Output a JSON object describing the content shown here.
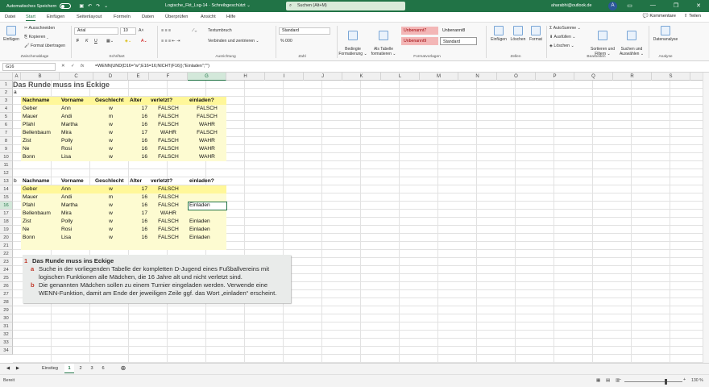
{
  "titlebar": {
    "autosave": "Automatisches Speichern",
    "doc": "Logische_Fkt_Lsg-14  ·  Schreibgeschützt ⌄",
    "search": "Suchen (Alt+M)",
    "user": "aharabhi@outlook.de",
    "avatar": "A",
    "min": "—",
    "max": "❐",
    "close": "✕",
    "ribbon_opt": "▭"
  },
  "menu": {
    "items": [
      "Datei",
      "Start",
      "Einfügen",
      "Seitenlayout",
      "Formeln",
      "Daten",
      "Überprüfen",
      "Ansicht",
      "Hilfe"
    ],
    "comments": "💬 Kommentare",
    "share": "⇧ Teilen"
  },
  "ribbon": {
    "paste": "Einfügen",
    "cut": "✂ Ausschneiden",
    "copy": "⎘ Kopieren ⌄",
    "painter": "🖌 Format übertragen",
    "clipboard": "Zwischenablage",
    "font": "Arial",
    "size": "10",
    "bold": "F",
    "italic": "K",
    "underline": "U",
    "grow": "A˄",
    "shrink": "A˅",
    "font_label": "Schriftart",
    "wrap": "Textumbruch",
    "merge": "Verbinden und zentrieren ⌄",
    "align_label": "Ausrichtung",
    "numfmt": "Standard",
    "num_label": "Zahl",
    "pct": "% 000",
    "cond": "Bedingte\nFormatierung ⌄",
    "table": "Als Tabelle\nformatieren ⌄",
    "styles_label": "Formatvorlagen",
    "style1": "Unbenannt7",
    "style2": "Unbenannt8",
    "style3": "Unbenannt9",
    "style4": "Standard",
    "ins": "Einfügen",
    "del": "Löschen",
    "fmt": "Format",
    "cells_label": "Zellen",
    "autosum": "Σ AutoSumme ⌄",
    "fill": "⬇ Ausfüllen ⌄",
    "clear": "◈ Löschen ⌄",
    "sort": "Sortieren und\nFiltern ⌄",
    "find": "Suchen und\nAuswählen ⌄",
    "edit_label": "Bearbeiten",
    "analyze": "Datenanalyse",
    "analyze_label": "Analyse"
  },
  "formula": {
    "cell": "G16",
    "fx": "fx",
    "text": "=WENN(UND(D16=\"w\";E16=16;NICHT(F16));\"Einladen\";\"\")"
  },
  "columns": [
    "A",
    "B",
    "C",
    "D",
    "E",
    "F",
    "G",
    "H",
    "I",
    "J",
    "K",
    "L",
    "M",
    "N",
    "O",
    "P",
    "Q",
    "R",
    "S"
  ],
  "rows": [
    "1",
    "2",
    "3",
    "4",
    "5",
    "6",
    "7",
    "8",
    "9",
    "10",
    "11",
    "12",
    "13",
    "14",
    "15",
    "16",
    "17",
    "18",
    "19",
    "20",
    "21",
    "22",
    "23",
    "24",
    "25",
    "26",
    "27",
    "28",
    "29",
    "30",
    "31",
    "32",
    "33",
    "34"
  ],
  "sheet": {
    "title": "Das Runde muss ins Eckige",
    "label_a": "a",
    "label_b": "b",
    "headers": [
      "Nachname",
      "Vorname",
      "Geschlecht",
      "Alter",
      "verletzt?",
      "einladen?"
    ],
    "table_a": [
      [
        "Geber",
        "Ann",
        "w",
        "17",
        "FALSCH",
        "FALSCH"
      ],
      [
        "Mauer",
        "Andi",
        "m",
        "16",
        "FALSCH",
        "FALSCH"
      ],
      [
        "Pfahl",
        "Martha",
        "w",
        "16",
        "FALSCH",
        "WAHR"
      ],
      [
        "Bellenbaum",
        "Mira",
        "w",
        "17",
        "WAHR",
        "FALSCH"
      ],
      [
        "Zist",
        "Polly",
        "w",
        "16",
        "FALSCH",
        "WAHR"
      ],
      [
        "Ne",
        "Rosi",
        "w",
        "16",
        "FALSCH",
        "WAHR"
      ],
      [
        "Bonn",
        "Lisa",
        "w",
        "16",
        "FALSCH",
        "WAHR"
      ]
    ],
    "table_b": [
      [
        "Geber",
        "Ann",
        "w",
        "17",
        "FALSCH",
        ""
      ],
      [
        "Mauer",
        "Andi",
        "m",
        "16",
        "FALSCH",
        ""
      ],
      [
        "Pfahl",
        "Martha",
        "w",
        "16",
        "FALSCH",
        "Einladen"
      ],
      [
        "Bellenbaum",
        "Mira",
        "w",
        "17",
        "WAHR",
        ""
      ],
      [
        "Zist",
        "Polly",
        "w",
        "16",
        "FALSCH",
        "Einladen"
      ],
      [
        "Ne",
        "Rosi",
        "w",
        "16",
        "FALSCH",
        "Einladen"
      ],
      [
        "Bonn",
        "Lisa",
        "w",
        "16",
        "FALSCH",
        "Einladen"
      ]
    ]
  },
  "task": {
    "num": "1",
    "title": "Das Runde muss ins Eckige",
    "a_label": "a",
    "a_text": "Suche in der vorliegenden Tabelle der kompletten D-Jugend eines Fußballvereins mit logischen Funktionen alle Mädchen, die 16 Jahre alt und nicht verletzt sind.",
    "b_label": "b",
    "b_text": "Die genannten Mädchen sollen zu einem Turnier eingeladen werden. Verwende eine WENN-Funktion, damit am Ende der jeweiligen Zeile ggf. das Wort „einladen“ erscheint."
  },
  "tabs": [
    "Einstieg",
    "1",
    "2",
    "3",
    "6"
  ],
  "add_sheet": "⊕",
  "status": {
    "ready": "Bereit",
    "zoom": "130 %",
    "minus": "−",
    "plus": "+"
  }
}
